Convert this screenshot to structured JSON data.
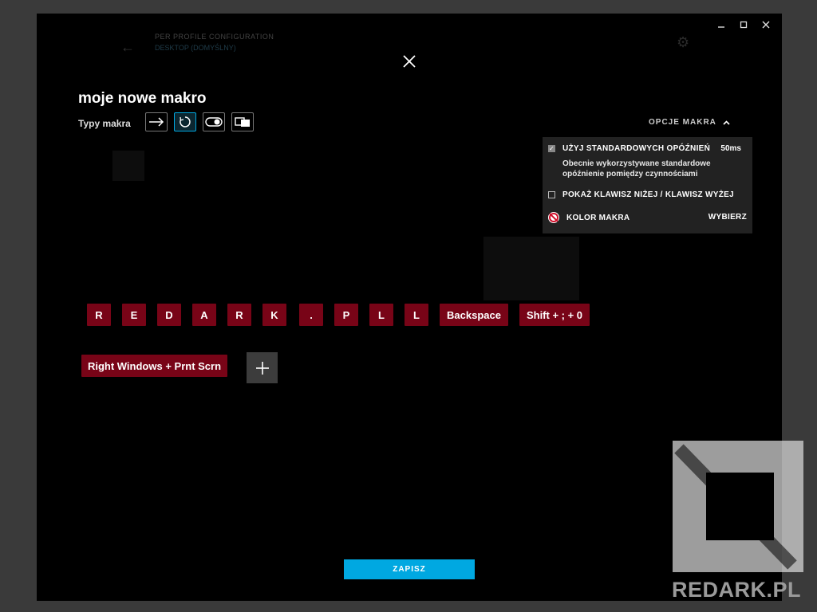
{
  "background": {
    "header_title": "PER PROFILE CONFIGURATION",
    "header_subtitle": "DESKTOP (DOMYŚLNY)"
  },
  "macro": {
    "title": "moje nowe makro",
    "types_label": "Typy makra"
  },
  "options": {
    "toggle_label": "OPCJE MAKRA",
    "use_default_delays_label": "UŻYJ STANDARDOWYCH OPÓŹNIEŃ",
    "use_default_delays_value": "50ms",
    "use_default_delays_checked": true,
    "description": "Obecnie wykorzystywane standardowe opóźnienie pomiędzy czynnościami",
    "show_keys_label": "POKAŻ KLAWISZ NIŻEJ / KLAWISZ WYŻEJ",
    "show_keys_checked": false,
    "macro_color_label": "KOLOR MAKRA",
    "choose_label": "WYBIERZ"
  },
  "keys_row1": [
    "R",
    "E",
    "D",
    "A",
    "R",
    "K",
    ".",
    "P",
    "L",
    "L",
    "Backspace",
    "Shift + ; + 0"
  ],
  "keys_row2": [
    "Right Windows + Prnt Scrn"
  ],
  "save_label": "ZAPISZ",
  "watermark": "REDARK.PL",
  "colors": {
    "accent": "#00a8e1",
    "key_bg": "#780417",
    "panel_bg": "#222222"
  }
}
